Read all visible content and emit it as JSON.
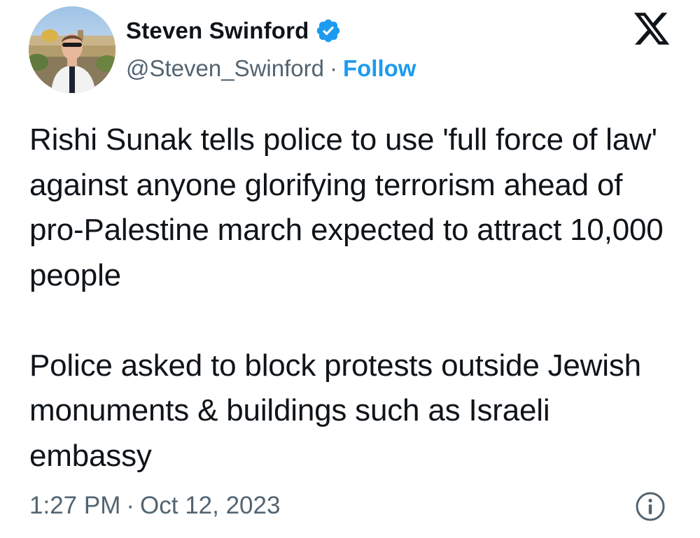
{
  "author": {
    "display_name": "Steven Swinford",
    "handle": "@Steven_Swinford",
    "verified_icon": "verified-badge-icon",
    "verified_color": "#1d9bf0"
  },
  "separator": "·",
  "follow_label": "Follow",
  "platform_icon": "x-logo-icon",
  "tweet": {
    "text": "Rishi Sunak tells police to use 'full force of law' against anyone glorifying terrorism ahead of pro-Palestine march expected to attract 10,000 people\n\nPolice asked to block protests outside Jewish monuments & buildings such as Israeli embassy"
  },
  "meta": {
    "time": "1:27 PM",
    "date": "Oct 12, 2023",
    "info_icon": "info-icon"
  },
  "colors": {
    "accent": "#1d9bf0",
    "text_primary": "#0f1419",
    "text_secondary": "#536471"
  }
}
